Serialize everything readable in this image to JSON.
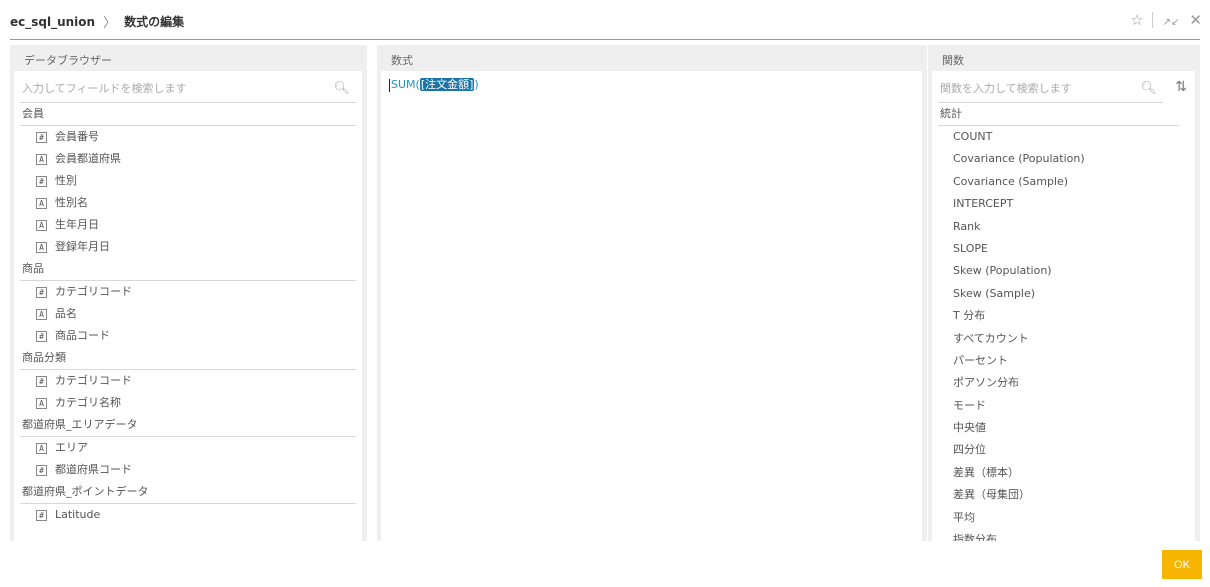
{
  "breadcrumb": {
    "source": "ec_sql_union",
    "separator": "〉",
    "current": "数式の編集"
  },
  "top_actions": {
    "favorite_icon": "star-outline",
    "collapse_icon": "collapse-arrows",
    "close_icon": "close"
  },
  "data_browser": {
    "title": "データブラウザー",
    "search_placeholder": "入力してフィールドを検索します",
    "groups": [
      {
        "name": "会員",
        "fields": [
          {
            "type": "#",
            "name": "会員番号"
          },
          {
            "type": "A",
            "name": "会員都道府県"
          },
          {
            "type": "#",
            "name": "性別"
          },
          {
            "type": "A",
            "name": "性別名"
          },
          {
            "type": "A",
            "name": "生年月日"
          },
          {
            "type": "A",
            "name": "登録年月日"
          }
        ]
      },
      {
        "name": "商品",
        "fields": [
          {
            "type": "#",
            "name": "カテゴリコード"
          },
          {
            "type": "A",
            "name": "品名"
          },
          {
            "type": "#",
            "name": "商品コード"
          }
        ]
      },
      {
        "name": "商品分類",
        "fields": [
          {
            "type": "#",
            "name": "カテゴリコード"
          },
          {
            "type": "A",
            "name": "カテゴリ名称"
          }
        ]
      },
      {
        "name": "都道府県_エリアデータ",
        "fields": [
          {
            "type": "A",
            "name": "エリア"
          },
          {
            "type": "#",
            "name": "都道府県コード"
          }
        ]
      },
      {
        "name": "都道府県_ポイントデータ",
        "fields": [
          {
            "type": "#",
            "name": "Latitude"
          }
        ]
      }
    ]
  },
  "formula_panel": {
    "title": "数式",
    "func": "SUM(",
    "field_ref": "[注文金額]",
    "close": ")"
  },
  "functions_panel": {
    "title": "関数",
    "search_placeholder": "関数を入力して検索します",
    "category": "統計",
    "items": [
      "COUNT",
      "Covariance (Population)",
      "Covariance (Sample)",
      "INTERCEPT",
      "Rank",
      "SLOPE",
      "Skew (Population)",
      "Skew (Sample)",
      "T 分布",
      "すべてカウント",
      "パーセント",
      "ポアソン分布",
      "モード",
      "中央値",
      "四分位",
      "差異（標本）",
      "差異（母集団）",
      "平均",
      "指数分布"
    ]
  },
  "footer": {
    "ok_label": "OK"
  },
  "colors": {
    "accent": "#f7b500",
    "formula_text": "#1b94c6",
    "formula_highlight": "#1a74a8",
    "panel_bg": "#efefef"
  }
}
